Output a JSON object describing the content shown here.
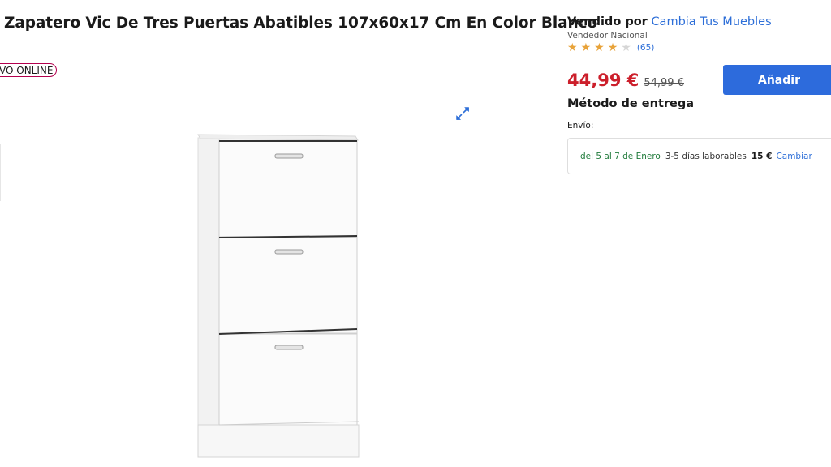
{
  "product": {
    "title": "Zapatero Vic De Tres Puertas Abatibles 107x60x17 Cm En Color Blanco",
    "badge": "VO ONLINE"
  },
  "gallery": {
    "expand_icon": "expand-arrows-icon",
    "image_alt": "Zapatero blanco de tres puertas abatibles"
  },
  "seller": {
    "sold_by_label": "Vendido por",
    "name": "Cambia Tus Muebles",
    "type": "Vendedor Nacional",
    "rating": 4,
    "rating_max": 5,
    "review_count": "(65)"
  },
  "price": {
    "current": "44,99 €",
    "old": "54,99 €"
  },
  "actions": {
    "add_label": "Añadir"
  },
  "delivery": {
    "heading": "Método de entrega",
    "shipping_label": "Envío:",
    "dates": "del 5 al 7 de Enero",
    "days": "3-5 días laborables",
    "cost": "15 €",
    "change_label": "Cambiar"
  },
  "colors": {
    "accent_blue": "#2d6bdc",
    "price_red": "#cc1f2b",
    "star_gold": "#e8a33a",
    "delivery_green": "#1f7a3a",
    "badge_border": "#b3004e"
  }
}
